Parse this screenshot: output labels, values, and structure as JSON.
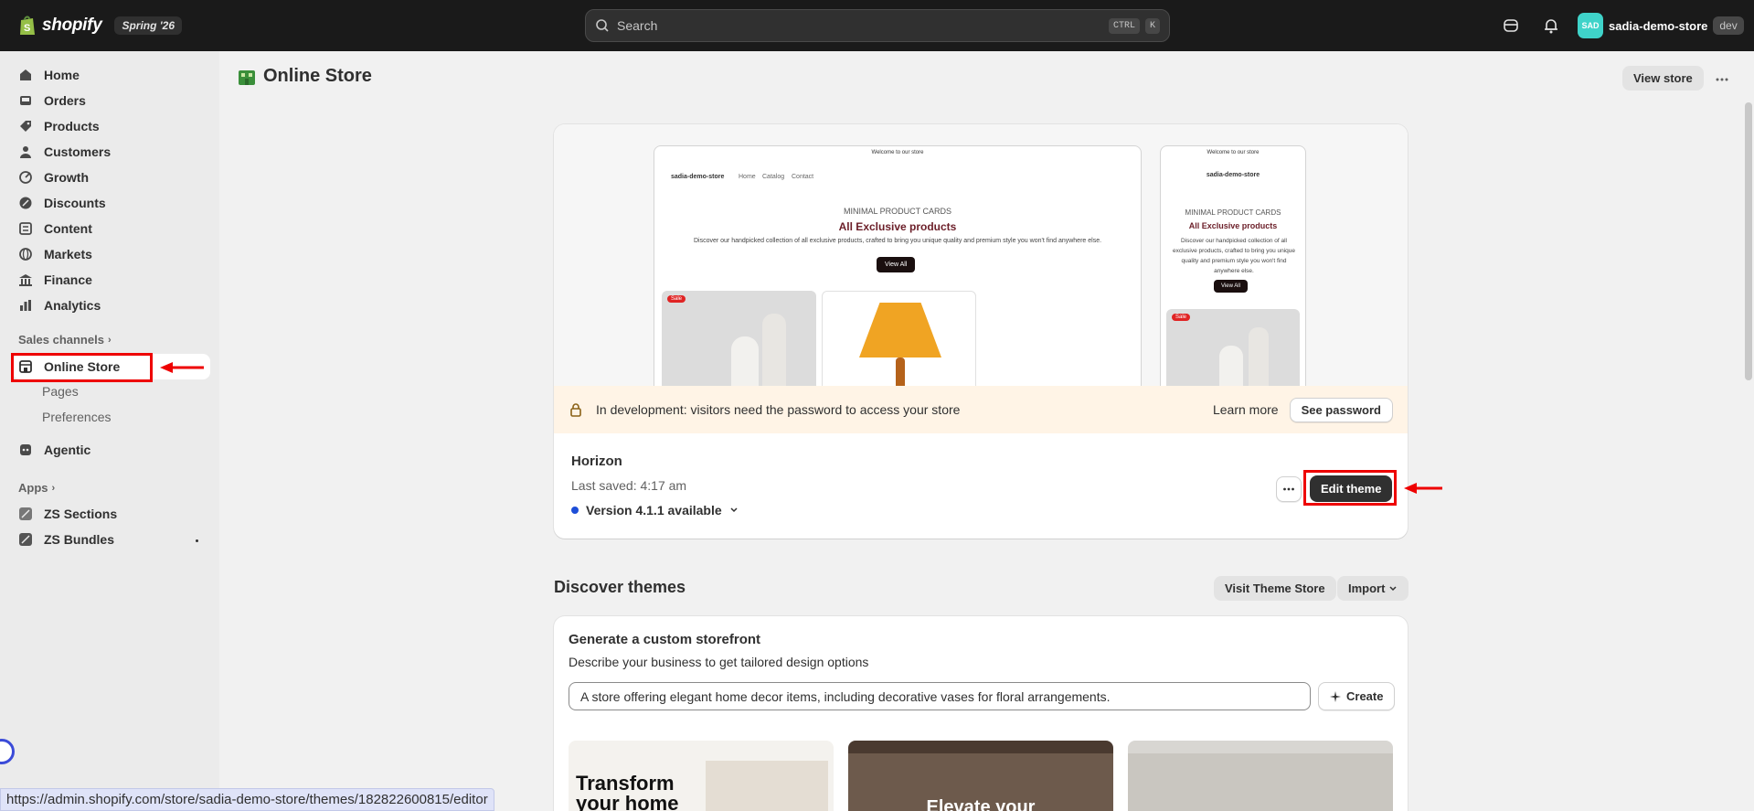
{
  "topbar": {
    "brand": "shopify",
    "edition": "Spring '26",
    "search_placeholder": "Search",
    "shortcut_key1": "CTRL",
    "shortcut_key2": "K",
    "avatar_initials": "SAD",
    "store_name": "sadia-demo-store",
    "store_badge": "dev"
  },
  "sidebar": {
    "items": [
      {
        "label": "Home",
        "icon": "home-icon"
      },
      {
        "label": "Orders",
        "icon": "inbox-icon"
      },
      {
        "label": "Products",
        "icon": "tag-icon"
      },
      {
        "label": "Customers",
        "icon": "person-icon"
      },
      {
        "label": "Growth",
        "icon": "growth-icon"
      },
      {
        "label": "Discounts",
        "icon": "discount-icon"
      },
      {
        "label": "Content",
        "icon": "content-icon"
      },
      {
        "label": "Markets",
        "icon": "globe-icon"
      },
      {
        "label": "Finance",
        "icon": "bank-icon"
      },
      {
        "label": "Analytics",
        "icon": "chart-icon"
      }
    ],
    "sales_channels": "Sales channels",
    "online_store": "Online Store",
    "pages": "Pages",
    "preferences": "Preferences",
    "agentic": "Agentic",
    "apps": "Apps",
    "app1": "ZS Sections",
    "app2": "ZS Bundles"
  },
  "header": {
    "title": "Online Store",
    "view_store": "View store"
  },
  "theme_preview": {
    "announcement": "Welcome to our store",
    "store": "sadia-demo-store",
    "nav_home": "Home",
    "nav_catalog": "Catalog",
    "nav_contact": "Contact",
    "eyebrow": "MINIMAL PRODUCT CARDS",
    "heading": "All Exclusive products",
    "desc": "Discover our handpicked collection of all exclusive products, crafted to bring you unique quality and premium style you won't find anywhere else.",
    "cta": "View All",
    "sale": "Sale"
  },
  "dev_banner": {
    "text": "In development: visitors need the password to access your store",
    "learn_more": "Learn more",
    "see_password": "See password"
  },
  "theme": {
    "name": "Horizon",
    "last_saved": "Last saved: 4:17 am",
    "version": "Version 4.1.1 available",
    "edit": "Edit theme"
  },
  "discover": {
    "title": "Discover themes",
    "visit": "Visit Theme Store",
    "import": "Import"
  },
  "generate": {
    "title": "Generate a custom storefront",
    "subtitle": "Describe your business to get tailored design options",
    "input_value": "A store offering elegant home decor items, including decorative vases for floral arrangements.",
    "create": "Create"
  },
  "thumbs": {
    "t1": "Transform your home",
    "t2": "Elevate your"
  },
  "status_url": "https://admin.shopify.com/store/sadia-demo-store/themes/182822600815/editor",
  "colors": {
    "accent": "#303030",
    "highlight": "#ee0000",
    "dot": "#1d4ed8"
  }
}
